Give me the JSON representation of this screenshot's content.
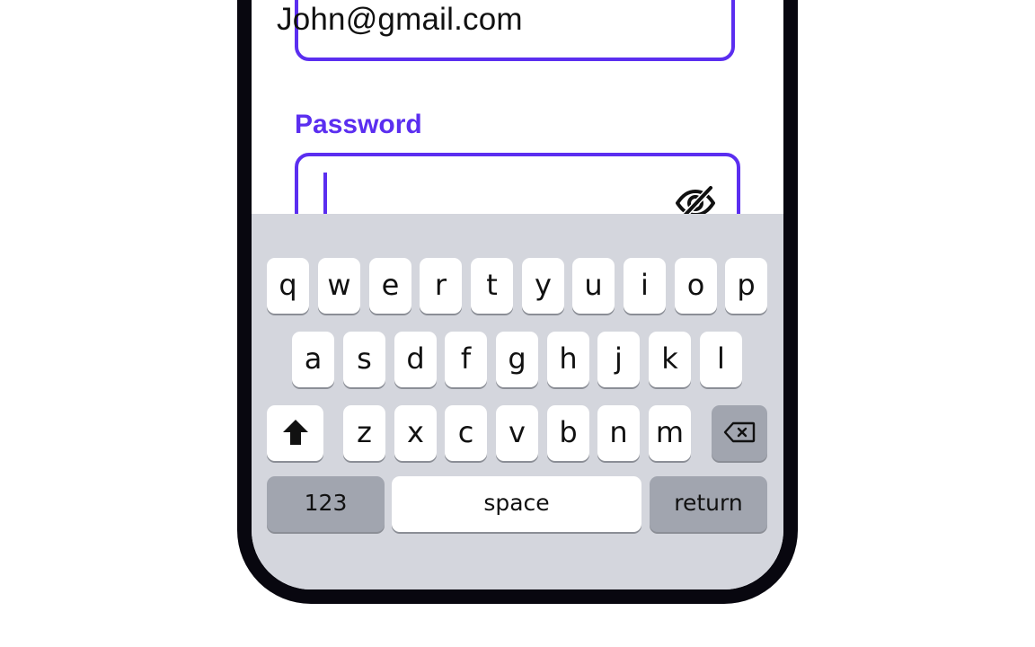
{
  "login_form": {
    "email_value": "John@gmail.com",
    "password_label": "Password",
    "password_value": "",
    "password_toggle_icon": "eye-off-icon"
  },
  "keyboard": {
    "row1": [
      "q",
      "w",
      "e",
      "r",
      "t",
      "y",
      "u",
      "i",
      "o",
      "p"
    ],
    "row2": [
      "a",
      "s",
      "d",
      "f",
      "g",
      "h",
      "j",
      "k",
      "l"
    ],
    "row3": [
      "z",
      "x",
      "c",
      "v",
      "b",
      "n",
      "m"
    ],
    "shift_icon": "shift-arrow-icon",
    "delete_icon": "backspace-icon",
    "numbers_label": "123",
    "space_label": "space",
    "return_label": "return"
  },
  "colors": {
    "accent": "#5b2ef0",
    "keyboard_bg": "#d4d6dd",
    "special_key_bg": "#a1a5af",
    "phone_frame": "#08070f"
  }
}
